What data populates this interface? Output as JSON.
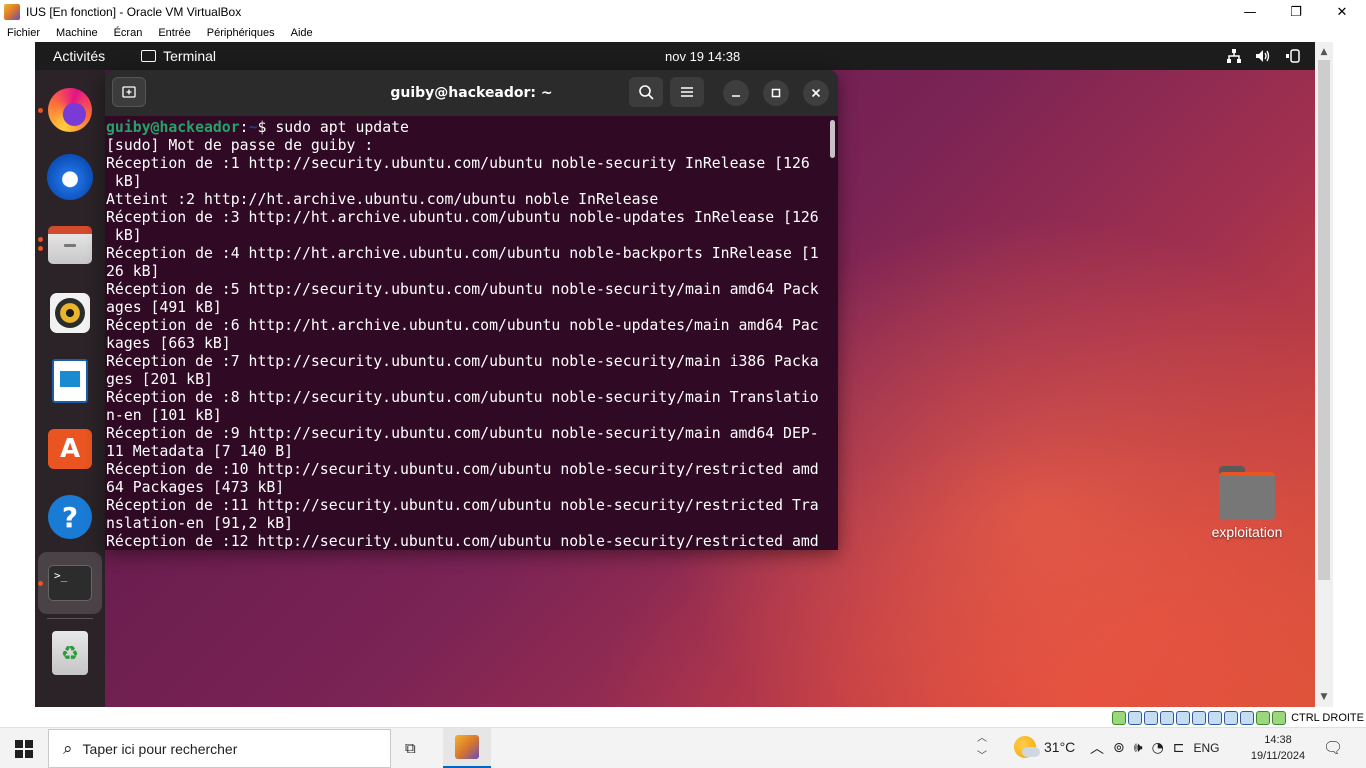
{
  "host_window": {
    "title": "IUS [En fonction] - Oracle VM VirtualBox",
    "controls": {
      "minimize": "—",
      "maximize": "❐",
      "close": "✕"
    },
    "menu": [
      "Fichier",
      "Machine",
      "Écran",
      "Entrée",
      "Périphériques",
      "Aide"
    ]
  },
  "guest": {
    "topbar": {
      "activities": "Activités",
      "app_name": "Terminal",
      "clock": "nov 19  14:38"
    },
    "dock": [
      {
        "name": "firefox-icon",
        "running": true
      },
      {
        "name": "thunderbird-icon",
        "running": false
      },
      {
        "name": "files-icon",
        "running": true
      },
      {
        "name": "rhythmbox-icon",
        "running": false
      },
      {
        "name": "libreoffice-writer-icon",
        "running": false
      },
      {
        "name": "app-center-icon",
        "running": false
      },
      {
        "name": "help-icon",
        "running": false
      },
      {
        "name": "terminal-icon",
        "running": true
      },
      {
        "name": "trash-icon",
        "running": false
      }
    ],
    "terminal": {
      "title": "guiby@hackeador: ~",
      "prompt_user": "guiby@hackeador",
      "prompt_sep": ":",
      "prompt_path": "~",
      "prompt_symbol": "$ ",
      "command": "sudo apt update",
      "output": [
        "[sudo] Mot de passe de guiby :",
        "Réception de :1 http://security.ubuntu.com/ubuntu noble-security InRelease [126",
        " kB]",
        "Atteint :2 http://ht.archive.ubuntu.com/ubuntu noble InRelease",
        "Réception de :3 http://ht.archive.ubuntu.com/ubuntu noble-updates InRelease [126",
        " kB]",
        "Réception de :4 http://ht.archive.ubuntu.com/ubuntu noble-backports InRelease [1",
        "26 kB]",
        "Réception de :5 http://security.ubuntu.com/ubuntu noble-security/main amd64 Pack",
        "ages [491 kB]",
        "Réception de :6 http://ht.archive.ubuntu.com/ubuntu noble-updates/main amd64 Pac",
        "kages [663 kB]",
        "Réception de :7 http://security.ubuntu.com/ubuntu noble-security/main i386 Packa",
        "ges [201 kB]",
        "Réception de :8 http://security.ubuntu.com/ubuntu noble-security/main Translatio",
        "n-en [101 kB]",
        "Réception de :9 http://security.ubuntu.com/ubuntu noble-security/main amd64 DEP-",
        "11 Metadata [7 140 B]",
        "Réception de :10 http://security.ubuntu.com/ubuntu noble-security/restricted amd",
        "64 Packages [473 kB]",
        "Réception de :11 http://security.ubuntu.com/ubuntu noble-security/restricted Tra",
        "nslation-en [91,2 kB]",
        "Réception de :12 http://security.ubuntu.com/ubuntu noble-security/restricted amd"
      ]
    },
    "desktop_folder": {
      "label": "exploitation"
    }
  },
  "vbox_status": {
    "host_key": "CTRL DROITE"
  },
  "taskbar": {
    "search_placeholder": "Taper ici pour rechercher",
    "weather_temp": "31°C",
    "language": "ENG",
    "time": "14:38",
    "date": "19/11/2024"
  },
  "colors": {
    "ubuntu_orange": "#e95420",
    "terminal_bg": "#300a24",
    "prompt_user": "#26a269",
    "prompt_path": "#12488b"
  }
}
